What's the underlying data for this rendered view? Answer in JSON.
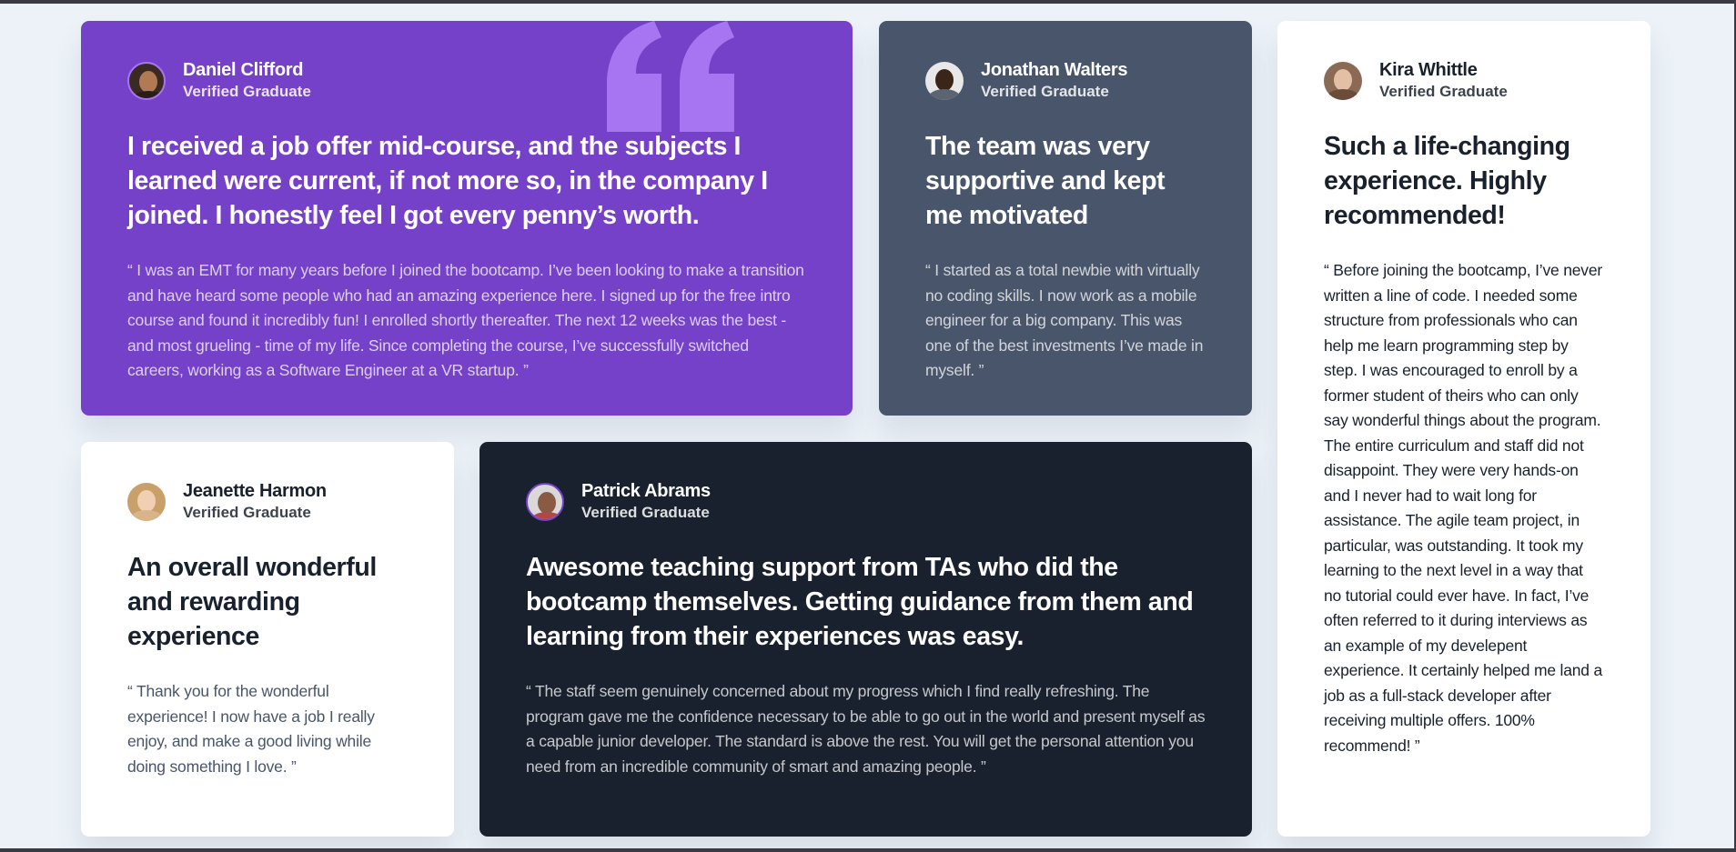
{
  "testimonials": [
    {
      "name": "Daniel Clifford",
      "role": "Verified Graduate",
      "headline": "I received a job offer mid-course, and the subjects I learned were current, if not more so, in the company I joined. I honestly feel I got every penny’s worth.",
      "body": "“ I was an EMT for many years before I joined the bootcamp. I’ve been looking to make a transition and have heard some people who had an amazing experience here. I signed up for the free intro course and found it incredibly fun! I enrolled shortly thereafter. The next 12 weeks was the best - and most grueling - time of my life. Since completing the course, I’ve successfully switched careers, working as a Software Engineer at a VR startup. ”",
      "background": "#7541c8"
    },
    {
      "name": "Jonathan Walters",
      "role": "Verified Graduate",
      "headline": "The team was very supportive and kept me motivated",
      "body": "“ I started as a total newbie with virtually no coding skills. I now work as a mobile engineer for a big company. This was one of the best investments I’ve made in myself. ”",
      "background": "#48556a"
    },
    {
      "name": "Kira Whittle",
      "role": "Verified Graduate",
      "headline": "Such a life-changing experience. Highly recommended!",
      "body": "“ Before joining the bootcamp, I’ve never written a line of code. I needed some structure from professionals who can help me learn programming step by step. I was encouraged to enroll by a former student of theirs who can only say wonderful things about the program. The entire curriculum and staff did not disappoint. They were very hands-on and I never had to wait long for assistance. The agile team project, in particular, was outstanding. It took my learning to the next level in a way that no tutorial could ever have. In fact, I’ve often referred to it during interviews as an example of my develepent experience. It certainly helped me land a job as a full-stack developer after receiving multiple offers. 100% recommend! ”",
      "background": "#ffffff"
    },
    {
      "name": "Jeanette Harmon",
      "role": "Verified Graduate",
      "headline": "An overall wonderful and rewarding experience",
      "body": "“ Thank you for the wonderful experience! I now have a job I really enjoy, and make a good living while doing something I love. ”",
      "background": "#ffffff"
    },
    {
      "name": "Patrick Abrams",
      "role": "Verified Graduate",
      "headline": "Awesome teaching support from TAs who did the bootcamp themselves. Getting guidance from them and learning from their experiences was easy.",
      "body": "“ The staff seem genuinely concerned about my progress which I find really refreshing. The program gave me the confidence necessary to be able to go out in the world and present myself as a capable junior developer. The standard is above the rest. You will get the personal attention you need from an incredible community of smart and amazing people. ”",
      "background": "#19212e"
    }
  ],
  "icons": {
    "quote": "quote-icon",
    "avatar": "avatar-icon"
  },
  "colors": {
    "page_background": "#ecf2f8",
    "purple": "#7541c8",
    "grayish_blue": "#48556a",
    "dark_blackish_blue": "#19212e",
    "white": "#ffffff",
    "quote_mark": "#a775f1"
  }
}
